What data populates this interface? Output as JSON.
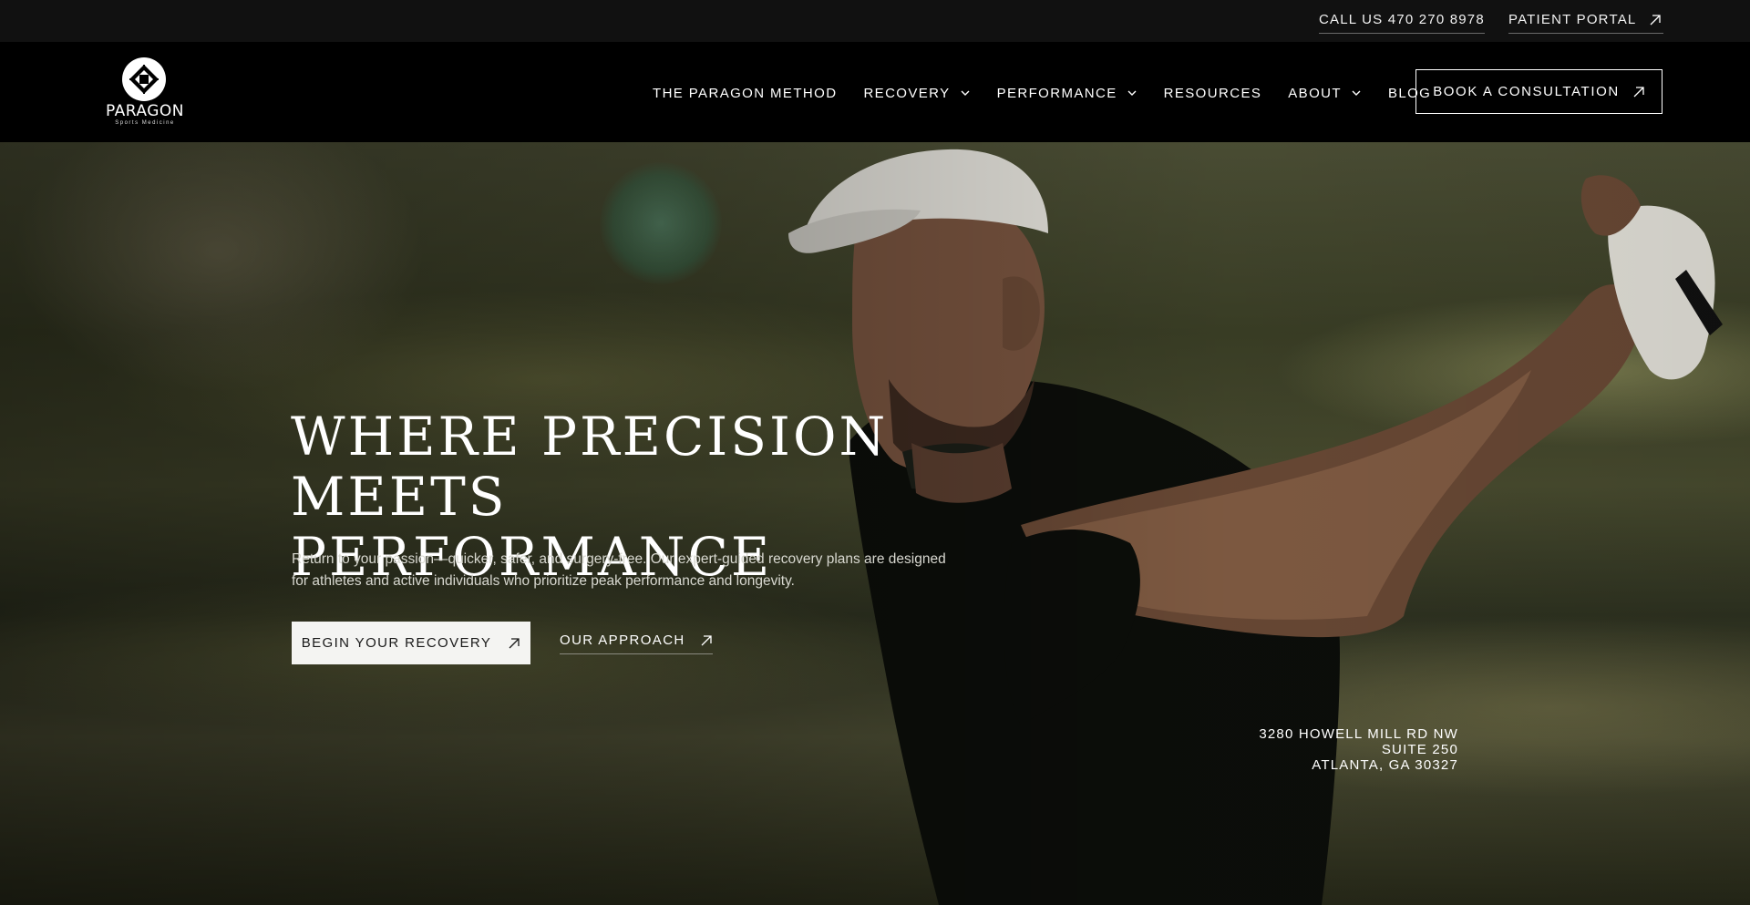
{
  "topbar": {
    "call_label": "CALL US 470 270 8978",
    "portal_label": "PATIENT PORTAL"
  },
  "brand": {
    "name": "PARAGON",
    "tagline": "Sports Medicine"
  },
  "nav": {
    "items": [
      {
        "label": "THE PARAGON METHOD",
        "dropdown": false
      },
      {
        "label": "RECOVERY",
        "dropdown": true
      },
      {
        "label": "PERFORMANCE",
        "dropdown": true
      },
      {
        "label": "RESOURCES",
        "dropdown": false
      },
      {
        "label": "ABOUT",
        "dropdown": true
      },
      {
        "label": "BLOG",
        "dropdown": false
      }
    ],
    "cta_label": "BOOK A CONSULTATION"
  },
  "hero": {
    "headline_line1": "WHERE PRECISION",
    "headline_line2": "MEETS PERFORMANCE",
    "subtext": "Return to your passion—quicker, safer, and surgery-free. Our expert-guided recovery plans are designed for athletes and active individuals who prioritize peak performance and longevity.",
    "primary_button": "BEGIN YOUR RECOVERY",
    "secondary_button": "OUR APPROACH"
  },
  "address": {
    "line1": "3280 HOWELL MILL RD NW",
    "line2": "SUITE 250",
    "line3": "ATLANTA, GA 30327"
  },
  "colors": {
    "topbar_bg": "#111111",
    "header_bg": "#000000",
    "primary_button_bg": "#f4f4f2",
    "text": "#ffffff"
  },
  "icons": {
    "arrow": "arrow-up-right-icon",
    "chevron": "chevron-down-icon",
    "logo": "paragon-logo-mark"
  }
}
